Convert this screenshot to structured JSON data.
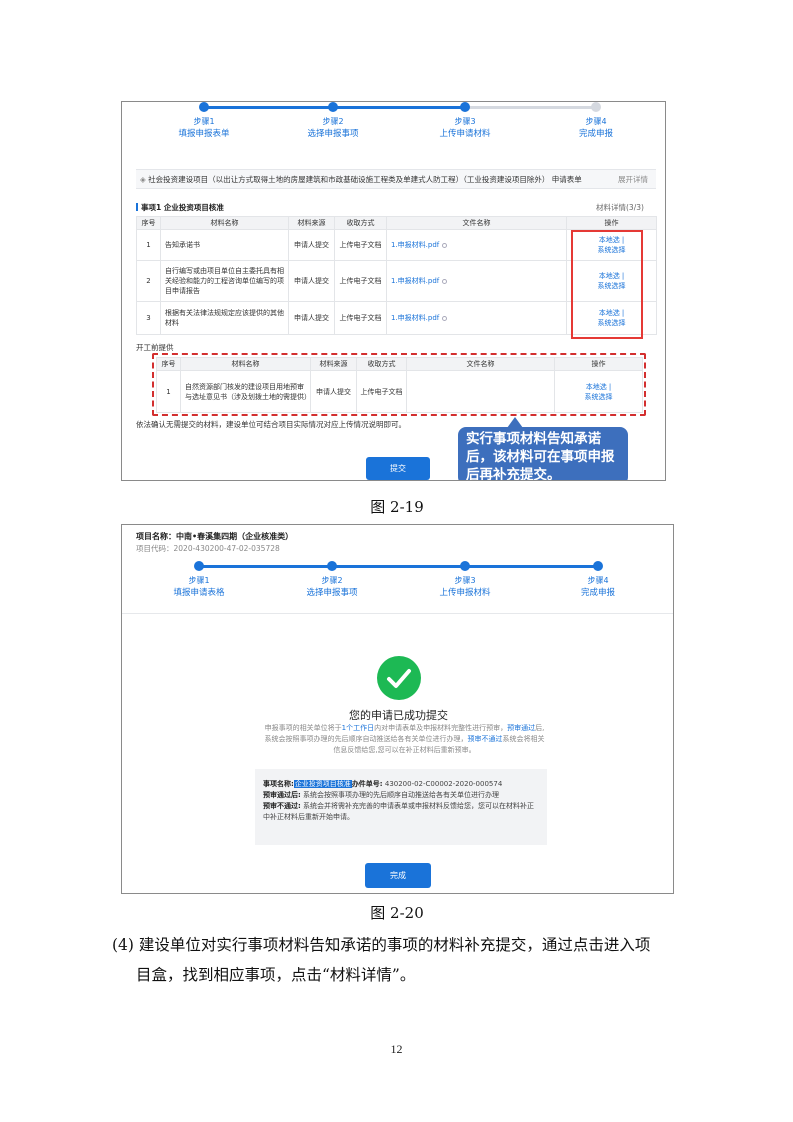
{
  "figure1": {
    "caption": "图 2-19",
    "steps": [
      {
        "name": "步骤1",
        "desc": "填报申报表单"
      },
      {
        "name": "步骤2",
        "desc": "选择申报事项"
      },
      {
        "name": "步骤3",
        "desc": "上传申请材料"
      },
      {
        "name": "步骤4",
        "desc": "完成申报"
      }
    ],
    "project_bar": "社会投资建设项目（以出让方式取得土地的房屋建筑和市政基础设施工程类及单建式人防工程）（工业投资建设项目除外） 申请表单",
    "project_bar_toggle": "展开详情",
    "section_title": "事项1 企业投资项目核准",
    "material_detail": "材料详情(3/3)",
    "table_headers": [
      "序号",
      "材料名称",
      "材料来源",
      "收取方式",
      "文件名称",
      "操作"
    ],
    "rows": [
      {
        "no": "1",
        "name": "告知承诺书",
        "source": "申请人提交",
        "method": "上传电子文档",
        "file": "1.申报材料.pdf",
        "op1": "本地选",
        "op2": "系统选择"
      },
      {
        "no": "2",
        "name": "自行编写或由项目单位自主委托具有相关经验和能力的工程咨询单位编写的项目申请报告",
        "source": "申请人提交",
        "method": "上传电子文档",
        "file": "1.申报材料.pdf",
        "op1": "本地选",
        "op2": "系统选择"
      },
      {
        "no": "3",
        "name": "根据有关法律法规规定应该提供的其他材料",
        "source": "申请人提交",
        "method": "上传电子文档",
        "file": "1.申报材料.pdf",
        "op1": "本地选",
        "op2": "系统选择"
      }
    ],
    "pre_label": "开工前提供",
    "table2_headers": [
      "序号",
      "材料名称",
      "材料来源",
      "收取方式",
      "文件名称",
      "操作"
    ],
    "rows2": [
      {
        "no": "1",
        "name": "自然资源部门核发的建设项目用地预审与选址意见书（涉及划拨土地的需提供）",
        "source": "申请人提交",
        "method": "上传电子文档",
        "file": "",
        "op1": "本地选",
        "op2": "系统选择"
      }
    ],
    "note": "依法确认无需提交的材料，建设单位可结合项目实际情况对应上传情况说明即可。",
    "callout": "实行事项材料告知承诺后，该材料可在事项申报后再补充提交。",
    "submit_label": "提交"
  },
  "figure2": {
    "caption": "图 2-20",
    "project_name": "项目名称：中南•春溪集四期（企业核准类）",
    "project_code": "项目代码：2020-430200-47-02-035728",
    "steps": [
      {
        "name": "步骤1",
        "desc": "填报申请表格"
      },
      {
        "name": "步骤2",
        "desc": "选择申报事项"
      },
      {
        "name": "步骤3",
        "desc": "上传申报材料"
      },
      {
        "name": "步骤4",
        "desc": "完成申报"
      }
    ],
    "success_title": "您的申请已成功提交",
    "desc_a": "申报事项的相关单位将于",
    "desc_hl1": "1个工作日",
    "desc_b": "内对申请表单及申报材料完整性进行预审，",
    "desc_hl2": "预审通过",
    "desc_c": "后,系统会按照事项办理的先后顺序自动推送给各有关单位进行办理，",
    "desc_hl3": "预审不通过",
    "desc_d": "系统会将相关信息反馈给您,您可以在补正材料后重新预审。",
    "info_item_label": "事项名称:",
    "info_item_value": "企业投资项目核准",
    "info_no_label": "办件单号:",
    "info_no_value": "430200-02-C00002-2020-000574",
    "info_pass_label": "预审通过后:",
    "info_pass_text": "系统会按照事项办理的先后顺序自动推送给各有关单位进行办理",
    "info_fail_label": "预审不通过:",
    "info_fail_text": "系统会并将需补充完善的申请表单或申报材料反馈给您，您可以在材料补正中补正材料后重新开始申请。",
    "done_label": "完成"
  },
  "body_text_line1": "(4) 建设单位对实行事项材料告知承诺的事项的材料补充提交，通过点击进入项",
  "body_text_line2": "目盒，找到相应事项，点击“材料详情”。",
  "page_number": "12"
}
